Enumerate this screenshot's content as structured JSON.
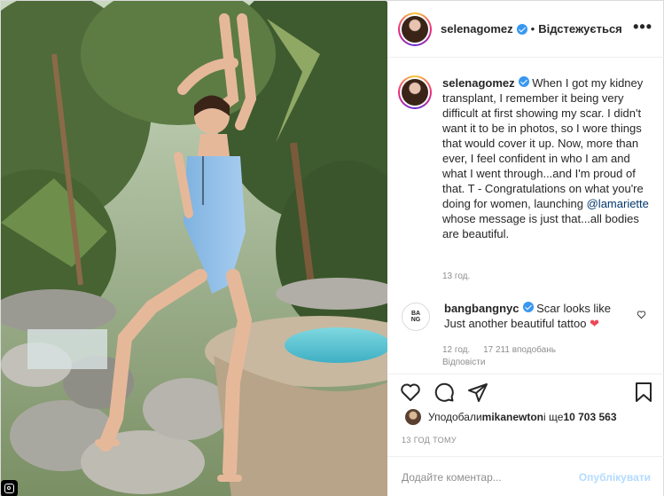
{
  "header": {
    "username": "selenagomez",
    "dot": "•",
    "follow_label": "Відстежується",
    "more_label": "•••"
  },
  "caption": {
    "username": "selenagomez",
    "text_before": " When I got my kidney transplant, I remember it being very difficult at first showing my scar. I didn't want it to be in photos, so I wore things that would cover it up. Now, more than ever, I feel confident in who I am and what I went through...and I'm proud of that. T - Congratulations on what you're doing for women, launching ",
    "mention": "@lamariette",
    "text_after": " whose message is just that...all bodies are beautiful.",
    "time": "13 год."
  },
  "comment": {
    "avatar_text": "BA\nNG",
    "username": "bangbangnyc",
    "text": " Scar looks like Just another beautiful tattoo ",
    "heart": "❤",
    "time": "12 год.",
    "likes": "17 211 вподобань",
    "reply": "Відповісти"
  },
  "likes": {
    "prefix": "Уподобали ",
    "user": "mikanewton",
    "middle": " і ще ",
    "count": "10 703 563"
  },
  "timestamp": "13 ГОД ТОМУ",
  "add_comment": {
    "placeholder": "Додайте коментар...",
    "publish_label": "Опублікувати"
  },
  "icons": {
    "like": "heart-icon",
    "comment": "comment-icon",
    "share": "share-icon",
    "save": "bookmark-icon",
    "verified": "verified-badge-icon",
    "corner": "instagram-icon"
  },
  "colors": {
    "verified": "#3897f0",
    "mention": "#00376b",
    "heart": "#ed4956",
    "publish": "#b3dbff"
  }
}
